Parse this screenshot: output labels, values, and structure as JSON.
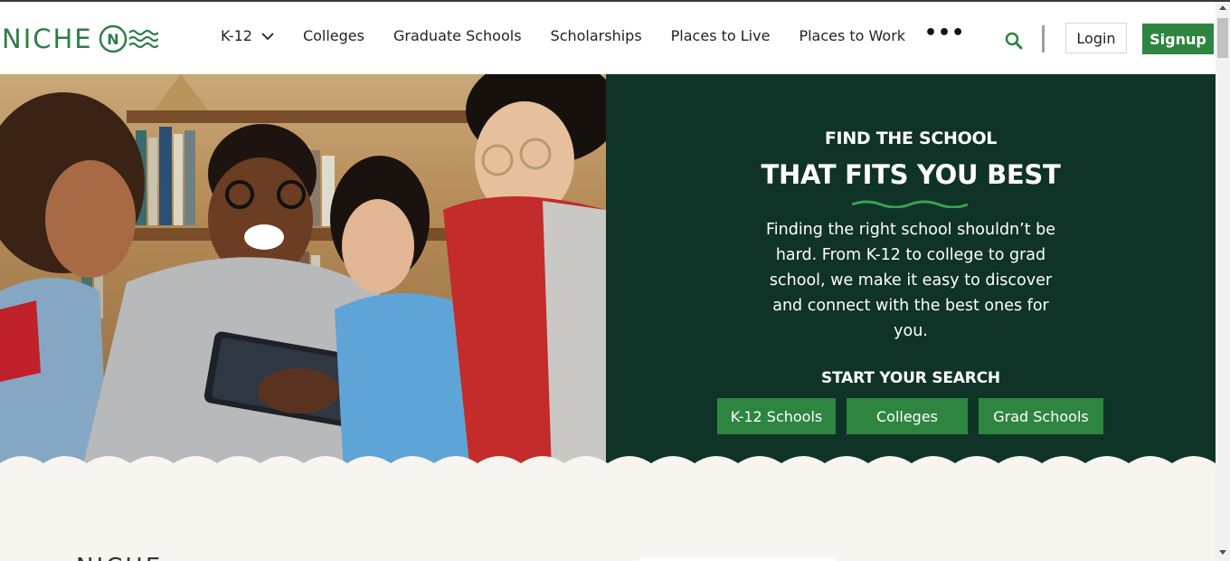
{
  "header": {
    "logo_text": "NICHE",
    "nav": [
      {
        "label": "K-12",
        "has_dropdown": true
      },
      {
        "label": "Colleges"
      },
      {
        "label": "Graduate Schools"
      },
      {
        "label": "Scholarships"
      },
      {
        "label": "Places to Live"
      },
      {
        "label": "Places to Work"
      }
    ],
    "more_label": "•••",
    "login_label": "Login",
    "signup_label": "Signup",
    "icons": {
      "search": "search-icon",
      "more": "more-dots-icon",
      "dropdown": "chevron-down-icon"
    }
  },
  "hero": {
    "eyebrow": "FIND THE SCHOOL",
    "headline": "THAT FITS YOU BEST",
    "description": "Finding the right school shouldn’t be hard. From K-12 to college to grad school, we make it easy to discover and connect with the best ones for you.",
    "search_label": "START YOUR SEARCH",
    "buttons": [
      "K-12 Schools",
      "Colleges",
      "Grad Schools"
    ]
  },
  "lower": {
    "logo_text": "NICHE"
  },
  "colors": {
    "brand_green": "#2e8540",
    "panel_dark": "#0f3326",
    "lower_bg": "#f8f4f0"
  }
}
